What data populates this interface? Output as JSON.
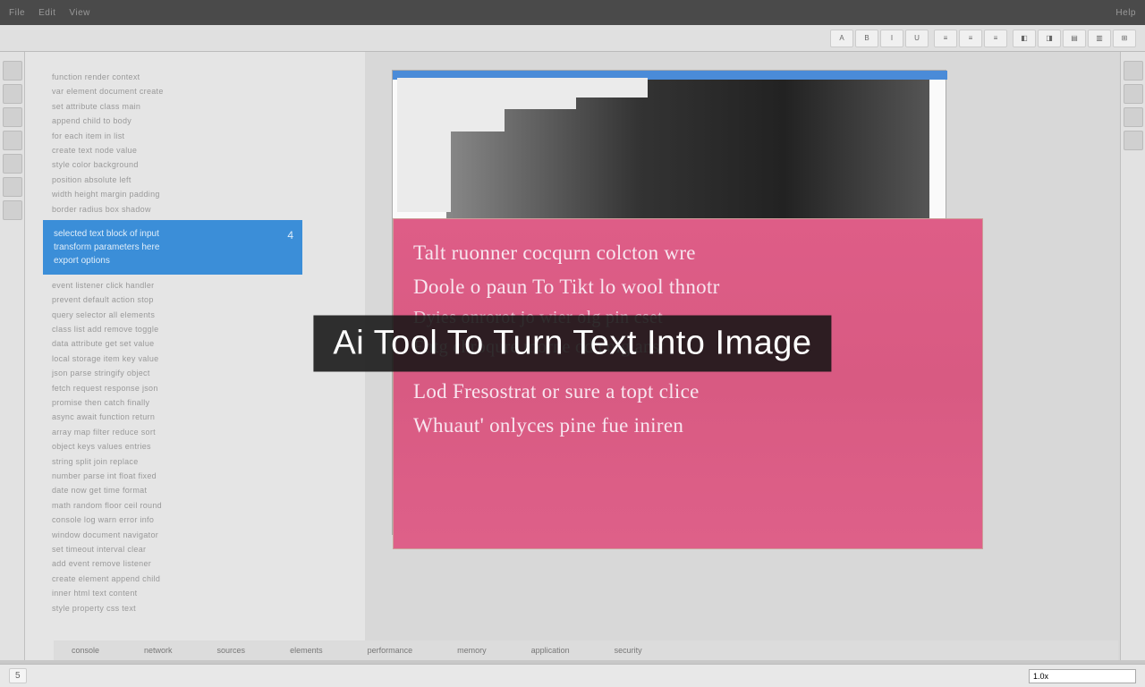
{
  "overlay": {
    "title": "Ai Tool To Turn Text Into Image"
  },
  "menubar": {
    "items": [
      "File",
      "Edit",
      "View"
    ],
    "right_items": [
      "Help"
    ]
  },
  "toolbar": {
    "buttons": [
      "A",
      "B",
      "I",
      "U",
      "≡",
      "≡",
      "≡",
      "◧",
      "◨",
      "▤",
      "▥",
      "⊞"
    ]
  },
  "left_panel": {
    "lines": [
      "function render context",
      "var element document create",
      "set attribute class main",
      "append child to body",
      "for each item in list",
      "create text node value",
      "style color background",
      "position absolute left",
      "width height margin padding",
      "border radius box shadow"
    ],
    "selection": {
      "line1": "selected text block of input",
      "line2": "transform parameters here",
      "line3": "export options",
      "num": "4"
    },
    "lines_after": [
      "event listener click handler",
      "prevent default action stop",
      "query selector all elements",
      "class list add remove toggle",
      "data attribute get set value",
      "local storage item key value",
      "json parse stringify object",
      "fetch request response json",
      "promise then catch finally",
      "async await function return",
      "array map filter reduce sort",
      "object keys values entries",
      "string split join replace",
      "number parse int float fixed",
      "date now get time format",
      "math random floor ceil round",
      "console log warn error info",
      "window document navigator",
      "set timeout interval clear",
      "add event remove listener",
      "create element append child",
      "inner html text content",
      "style property css text"
    ]
  },
  "pink_content": {
    "l1": "Talt ruonner cocqurn colcton wre",
    "l2": "Doole o paun  To  Tikt  lo  wool thnotr",
    "l3": "Dyies  onrorot  jo wier  olg  pin  cset",
    "l4": "Entg  chroqure  morne  od  colg  anst",
    "l5": "Lod  Fresostrat or sure a topt clice",
    "l6": "Whuaut' onlyces  pine  fue  iniren"
  },
  "footer": {
    "items": [
      "console",
      "network",
      "sources",
      "elements",
      "performance",
      "memory",
      "application",
      "security"
    ]
  },
  "status": {
    "page": "5",
    "field_value": "1.0x"
  }
}
